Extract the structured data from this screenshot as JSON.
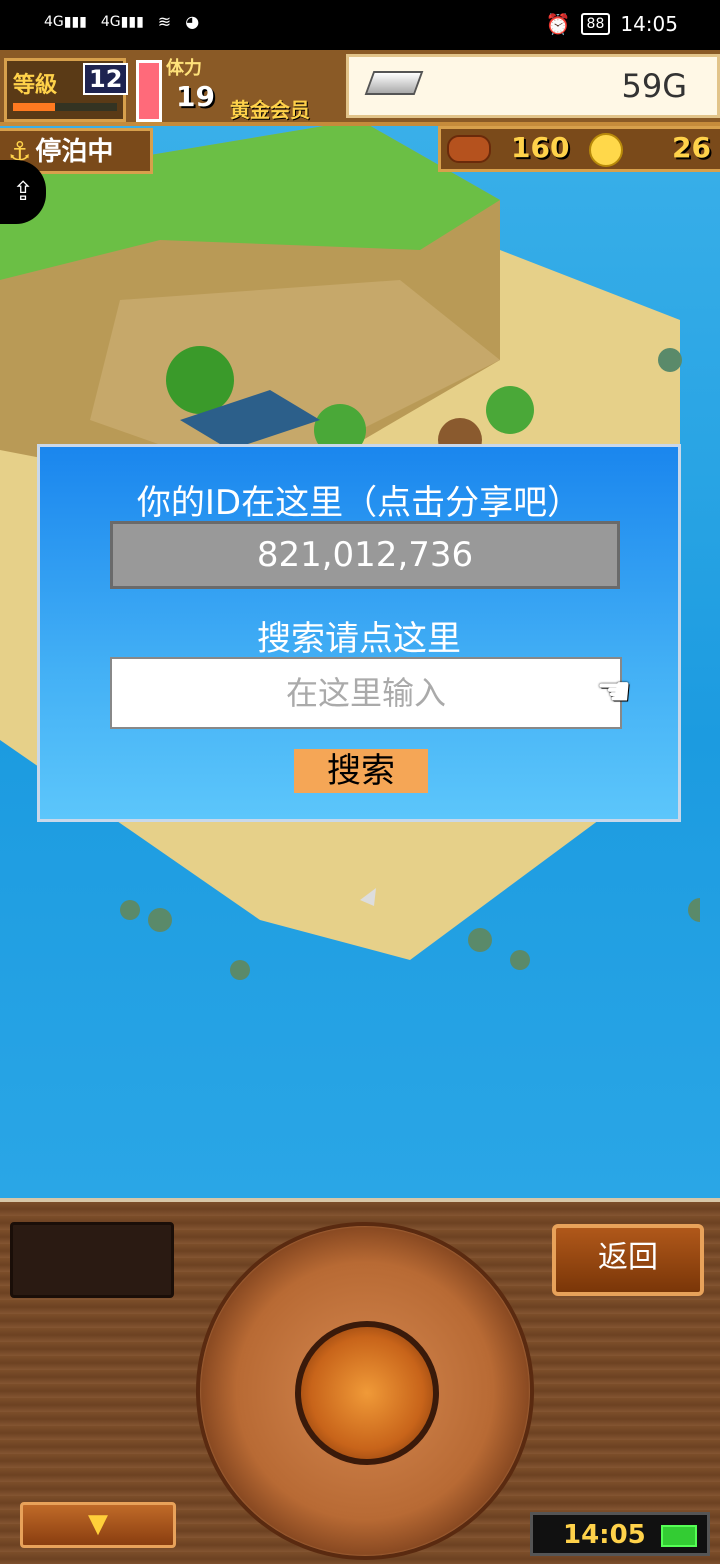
{
  "status_bar": {
    "signal1": "4G",
    "signal2": "4G",
    "battery": "88",
    "time": "14:05"
  },
  "hud": {
    "level_label": "等級",
    "level_value": "12",
    "stamina_label": "体力",
    "stamina_value": "19",
    "member_label": "黄金会员",
    "gold_value": "59G",
    "anchored_label": "停泊中",
    "food_value": "160",
    "coin_value": "26"
  },
  "dialog": {
    "title": "你的ID在这里（点击分享吧）",
    "player_id": "821,012,736",
    "search_label": "搜索请点这里",
    "search_placeholder": "在这里输入",
    "search_button": "搜索"
  },
  "controls": {
    "back_button": "返回",
    "clock": "14:05"
  },
  "icons": {
    "share": "share-icon",
    "anchor": "anchor-icon",
    "pointer_hand": "pointing-hand-icon"
  }
}
